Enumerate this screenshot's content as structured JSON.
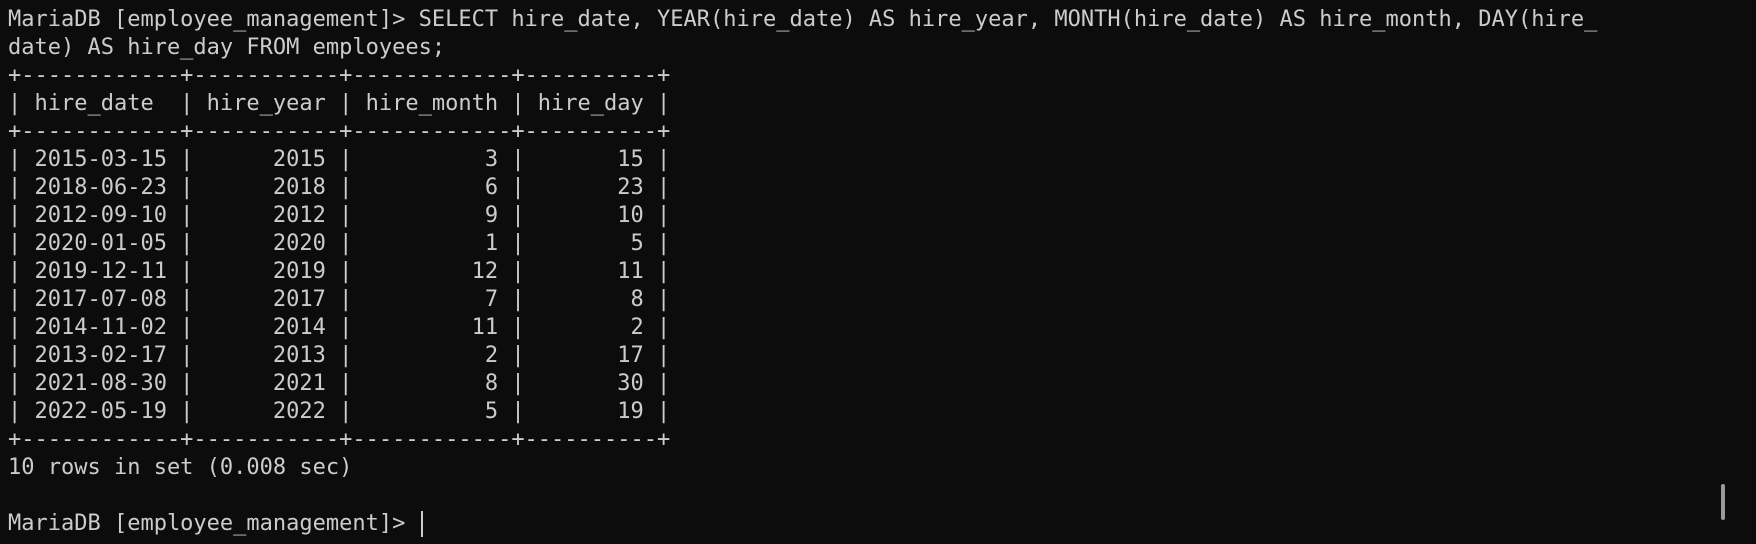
{
  "terminal": {
    "command_lines": [
      "MariaDB [employee_management]> SELECT hire_date, YEAR(hire_date) AS hire_year, MONTH(hire_date) AS hire_month, DAY(hire_",
      "date) AS hire_day FROM employees;"
    ],
    "table": {
      "border": "+------------+-----------+------------+----------+",
      "header": "| hire_date  | hire_year | hire_month | hire_day |",
      "columns": [
        "hire_date",
        "hire_year",
        "hire_month",
        "hire_day"
      ],
      "rows": [
        "| 2015-03-15 |      2015 |          3 |       15 |",
        "| 2018-06-23 |      2018 |          6 |       23 |",
        "| 2012-09-10 |      2012 |          9 |       10 |",
        "| 2020-01-05 |      2020 |          1 |        5 |",
        "| 2019-12-11 |      2019 |         12 |       11 |",
        "| 2017-07-08 |      2017 |          7 |        8 |",
        "| 2014-11-02 |      2014 |         11 |        2 |",
        "| 2013-02-17 |      2013 |          2 |       17 |",
        "| 2021-08-30 |      2021 |          8 |       30 |",
        "| 2022-05-19 |      2022 |          5 |       19 |"
      ]
    },
    "result_summary": "10 rows in set (0.008 sec)",
    "prompt": "MariaDB [employee_management]> "
  },
  "colors": {
    "background": "#0c0c0c",
    "foreground": "#cccccc",
    "scrollbar_thumb": "#9a9a9a"
  }
}
